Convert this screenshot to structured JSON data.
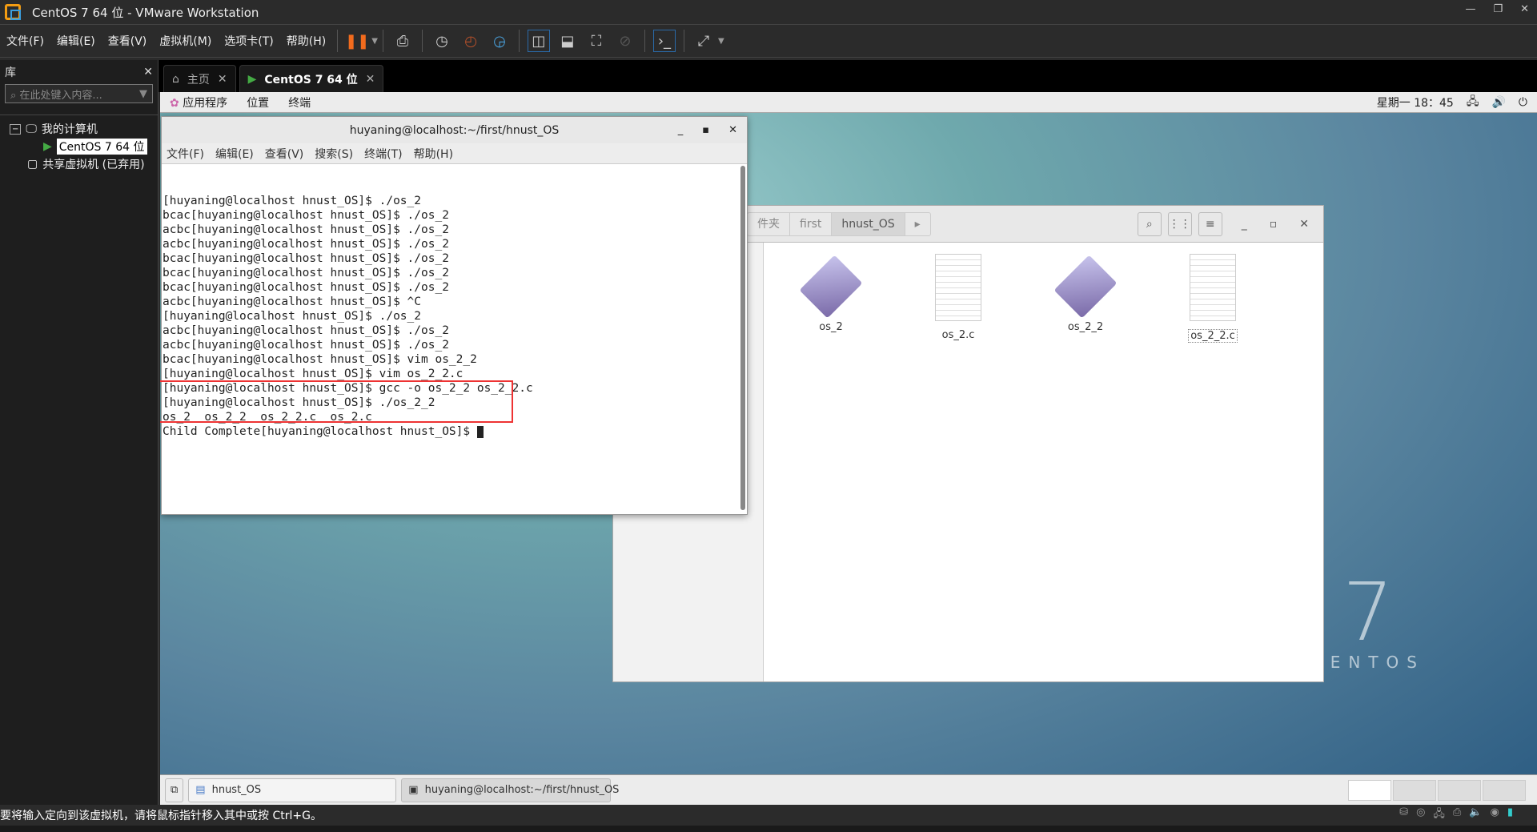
{
  "window": {
    "title": "CentOS 7 64 位 - VMware Workstation"
  },
  "menu": [
    "文件(F)",
    "编辑(E)",
    "查看(V)",
    "虚拟机(M)",
    "选项卡(T)",
    "帮助(H)"
  ],
  "library": {
    "title": "库",
    "search_placeholder": "在此处键入内容...",
    "tree": [
      "我的计算机",
      "CentOS 7 64 位",
      "共享虚拟机 (已弃用)"
    ]
  },
  "tabs": [
    {
      "label": "主页"
    },
    {
      "label": "CentOS 7 64 位",
      "active": true
    }
  ],
  "gnome": {
    "menus": [
      "应用程序",
      "位置",
      "终端"
    ],
    "clock": "星期一 18：45"
  },
  "terminal": {
    "title": "huyaning@localhost:~/first/hnust_OS",
    "menu": [
      "文件(F)",
      "编辑(E)",
      "查看(V)",
      "搜索(S)",
      "终端(T)",
      "帮助(H)"
    ],
    "lines": [
      "[huyaning@localhost hnust_OS]$ ./os_2",
      "bcac[huyaning@localhost hnust_OS]$ ./os_2",
      "acbc[huyaning@localhost hnust_OS]$ ./os_2",
      "acbc[huyaning@localhost hnust_OS]$ ./os_2",
      "bcac[huyaning@localhost hnust_OS]$ ./os_2",
      "bcac[huyaning@localhost hnust_OS]$ ./os_2",
      "bcac[huyaning@localhost hnust_OS]$ ./os_2",
      "acbc[huyaning@localhost hnust_OS]$ ^C",
      "[huyaning@localhost hnust_OS]$ ./os_2",
      "acbc[huyaning@localhost hnust_OS]$ ./os_2",
      "acbc[huyaning@localhost hnust_OS]$ ./os_2",
      "bcac[huyaning@localhost hnust_OS]$ vim os_2_2",
      "[huyaning@localhost hnust_OS]$ vim os_2_2.c",
      "[huyaning@localhost hnust_OS]$ gcc -o os_2_2 os_2_2.c",
      "[huyaning@localhost hnust_OS]$ ./os_2_2",
      "os_2  os_2_2  os_2_2.c  os_2.c",
      "Child Complete[huyaning@localhost hnust_OS]$ "
    ]
  },
  "files": {
    "breadcrumbs": [
      "件夹",
      "first",
      "hnust_OS"
    ],
    "items": [
      {
        "name": "os_2",
        "type": "executable"
      },
      {
        "name": "os_2.c",
        "type": "text"
      },
      {
        "name": "os_2_2",
        "type": "executable"
      },
      {
        "name": "os_2_2.c",
        "type": "text"
      }
    ]
  },
  "desktop": {
    "logo_number": "7",
    "logo_text": "CENTOS"
  },
  "taskbar": [
    "hnust_OS",
    "huyaning@localhost:~/first/hnust_OS"
  ],
  "status": {
    "hint": "要将输入定向到该虚拟机，请将鼠标指针移入其中或按 Ctrl+G。"
  },
  "colors": {
    "highlight_box": "#ee3333",
    "accent": "#f39c12"
  }
}
